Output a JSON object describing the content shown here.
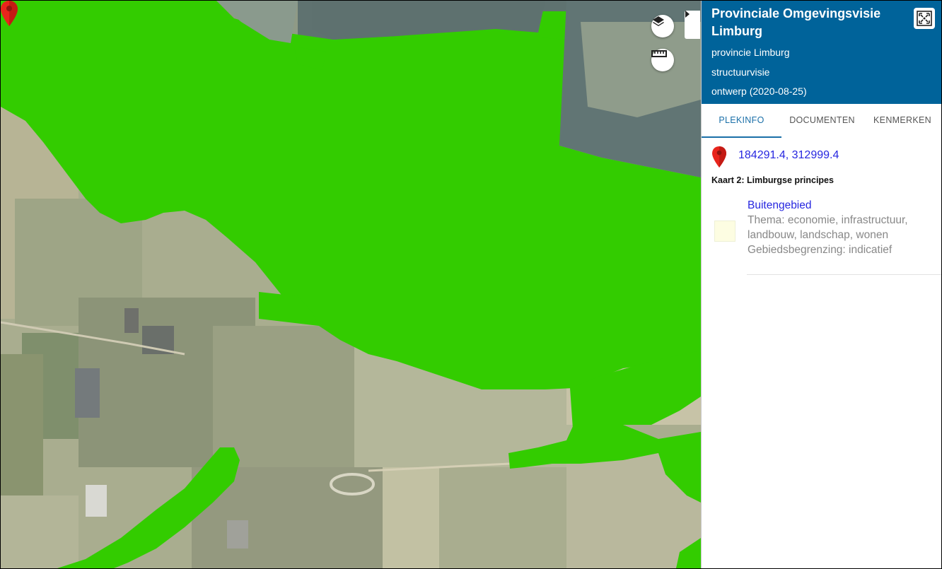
{
  "map": {
    "layers_icon": "layers-icon",
    "measure_icon": "ruler-icon",
    "collapse_icon": "caret-right-icon",
    "marker_icon": "map-marker-icon",
    "overlay_color": "#33cc00"
  },
  "panel": {
    "title": "Provinciale Omgevingsvisie Limburg",
    "publisher": "provincie Limburg",
    "type": "structuurvisie",
    "status": "ontwerp (2020-08-25)",
    "fullscreen_icon": "fullscreen-icon",
    "header_color": "#00639a"
  },
  "tabs": [
    {
      "label": "PLEKINFO",
      "active": true
    },
    {
      "label": "DOCUMENTEN",
      "active": false
    },
    {
      "label": "KENMERKEN",
      "active": false
    }
  ],
  "location": {
    "coordinates": "184291.4, 312999.4"
  },
  "section": {
    "title": "Kaart 2: Limburgse principes"
  },
  "feature": {
    "name": "Buitengebied",
    "thema": "Thema: economie, infrastructuur, landbouw, landschap, wonen",
    "begrenzing": "Gebiedsbegrenzing: indicatief",
    "swatch_color": "#fdfde2"
  }
}
